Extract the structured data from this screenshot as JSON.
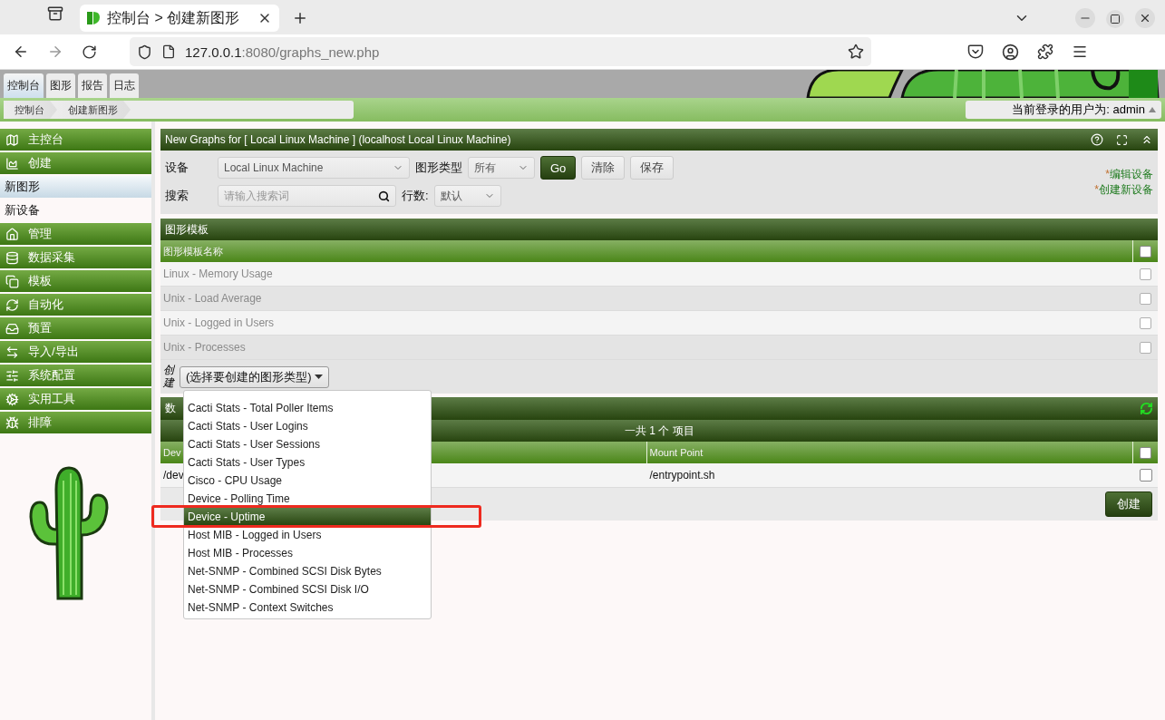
{
  "browser": {
    "tab_title": "控制台 > 创建新图形",
    "url_host": "127.0.0.1",
    "url_rest": ":8080/graphs_new.php"
  },
  "top_tabs": [
    {
      "label": "控制台",
      "selected": true
    },
    {
      "label": "图形",
      "selected": false
    },
    {
      "label": "报告",
      "selected": false
    },
    {
      "label": "日志",
      "selected": false
    }
  ],
  "breadcrumbs": [
    "控制台",
    "创建新图形"
  ],
  "user_menu": "当前登录的用户为: admin",
  "sidebar": {
    "items": [
      {
        "label": "主控台",
        "kind": "section"
      },
      {
        "label": "创建",
        "kind": "section"
      },
      {
        "label": "新图形",
        "kind": "link",
        "selected": true
      },
      {
        "label": "新设备",
        "kind": "link",
        "selected": false
      },
      {
        "label": "管理",
        "kind": "section"
      },
      {
        "label": "数据采集",
        "kind": "section"
      },
      {
        "label": "模板",
        "kind": "section"
      },
      {
        "label": "自动化",
        "kind": "section"
      },
      {
        "label": "预置",
        "kind": "section"
      },
      {
        "label": "导入/导出",
        "kind": "section"
      },
      {
        "label": "系统配置",
        "kind": "section"
      },
      {
        "label": "实用工具",
        "kind": "section"
      },
      {
        "label": "排障",
        "kind": "section"
      }
    ]
  },
  "panel": {
    "title": "New Graphs for [ Local Linux Machine ] (localhost Local Linux Machine)"
  },
  "filter": {
    "device_label": "设备",
    "device_value": "Local Linux Machine",
    "type_label": "图形类型",
    "type_value": "所有",
    "buttons": [
      {
        "label": "Go",
        "kind": "primary"
      },
      {
        "label": "清除",
        "kind": "plain"
      },
      {
        "label": "保存",
        "kind": "plain"
      }
    ],
    "search_label": "搜索",
    "search_placeholder": "请输入搜索词",
    "rows_label": "行数:",
    "rows_value": "默认",
    "links": [
      {
        "mark": "*",
        "label": "编辑设备"
      },
      {
        "mark": "*",
        "label": "创建新设备"
      }
    ]
  },
  "templates": {
    "title": "图形模板",
    "column": "图形模板名称",
    "all_checked": false,
    "rows": [
      {
        "name": "Linux - Memory Usage",
        "checked": false
      },
      {
        "name": "Unix - Load Average",
        "checked": false
      },
      {
        "name": "Unix - Logged in Users",
        "checked": false
      },
      {
        "name": "Unix - Processes",
        "checked": false
      }
    ],
    "create_label": "创建",
    "create_select": "(选择要创建的图形类型)"
  },
  "dropdown": {
    "options": [
      {
        "label": "Cacti Stats - Total Poller Items",
        "selected": false
      },
      {
        "label": "Cacti Stats - User Logins",
        "selected": false
      },
      {
        "label": "Cacti Stats - User Sessions",
        "selected": false
      },
      {
        "label": "Cacti Stats - User Types",
        "selected": false
      },
      {
        "label": "Cisco - CPU Usage",
        "selected": false
      },
      {
        "label": "Device - Polling Time",
        "selected": false
      },
      {
        "label": "Device - Uptime",
        "selected": true
      },
      {
        "label": "Host MIB - Logged in Users",
        "selected": false
      },
      {
        "label": "Host MIB - Processes",
        "selected": false
      },
      {
        "label": "Net-SNMP - Combined SCSI Disk Bytes",
        "selected": false
      },
      {
        "label": "Net-SNMP - Combined SCSI Disk I/O",
        "selected": false
      },
      {
        "label": "Net-SNMP - Context Switches",
        "selected": false
      }
    ]
  },
  "data_query": {
    "title": "数",
    "summary": "一共 1 个 项目",
    "columns": [
      "Dev",
      "Mount Point"
    ],
    "all_checked": false,
    "rows": [
      {
        "cells": [
          "/dev",
          "/entrypoint.sh"
        ],
        "checked": false
      }
    ],
    "create_button": "创建"
  },
  "annotation": {
    "kind": "red-box"
  }
}
